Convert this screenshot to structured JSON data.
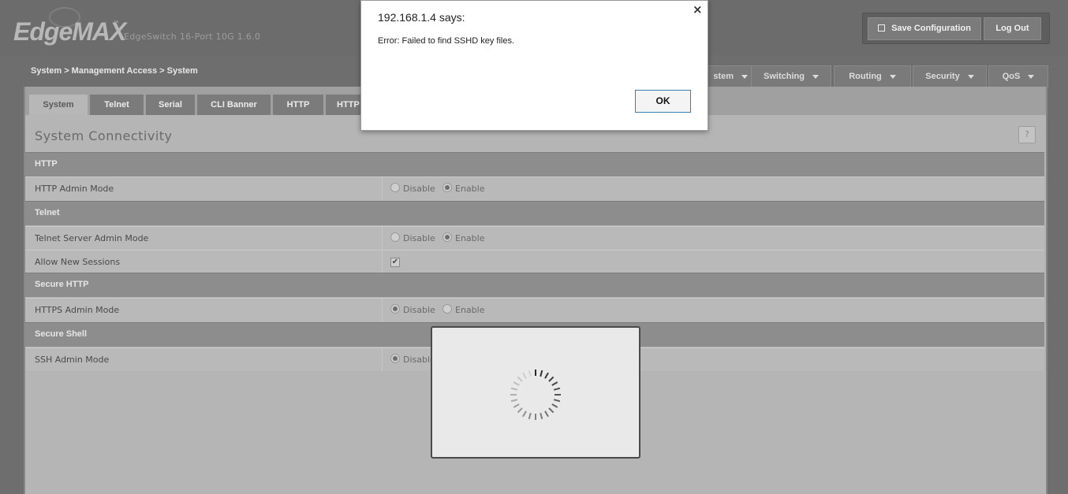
{
  "header": {
    "logo_text": "EdgeMAX",
    "logo_tm": "™",
    "device_name": "EdgeSwitch 16-Port 10G 1.6.0",
    "save_label": "Save Configuration",
    "logout_label": "Log Out"
  },
  "breadcrumb": "System > Management Access > System",
  "nav": {
    "items": [
      {
        "label": "stem"
      },
      {
        "label": "Switching"
      },
      {
        "label": "Routing"
      },
      {
        "label": "Security"
      },
      {
        "label": "QoS"
      }
    ]
  },
  "subtabs": [
    {
      "label": "System"
    },
    {
      "label": "Telnet"
    },
    {
      "label": "Serial"
    },
    {
      "label": "CLI Banner"
    },
    {
      "label": "HTTP"
    },
    {
      "label": "HTTP"
    }
  ],
  "page": {
    "title": "System Connectivity",
    "help_label": "?",
    "sections": {
      "http": "HTTP",
      "telnet": "Telnet",
      "secure_http": "Secure HTTP",
      "secure_shell": "Secure Shell"
    },
    "rows": {
      "http_admin": {
        "label": "HTTP Admin Mode",
        "disable": "Disable",
        "enable": "Enable",
        "selected": "Enable"
      },
      "telnet_admin": {
        "label": "Telnet Server Admin Mode",
        "disable": "Disable",
        "enable": "Enable",
        "selected": "Enable"
      },
      "allow_sessions": {
        "label": "Allow New Sessions",
        "checked": true
      },
      "https_admin": {
        "label": "HTTPS Admin Mode",
        "disable": "Disable",
        "enable": "Enable",
        "selected": "Disable"
      },
      "ssh_admin": {
        "label": "SSH Admin Mode",
        "disable": "Disable",
        "selected": "Disable"
      }
    }
  },
  "dialog": {
    "title": "192.168.1.4 says:",
    "close": "×",
    "message": "Error: Failed to find SSHD key files.",
    "ok": "OK"
  },
  "check_glyph": "✔",
  "colors": {
    "header_bg": "#6c6c6c",
    "section_bg": "#8d8d8d",
    "row_bg": "#b9b9b9",
    "ok_border": "#3c7fb1"
  }
}
